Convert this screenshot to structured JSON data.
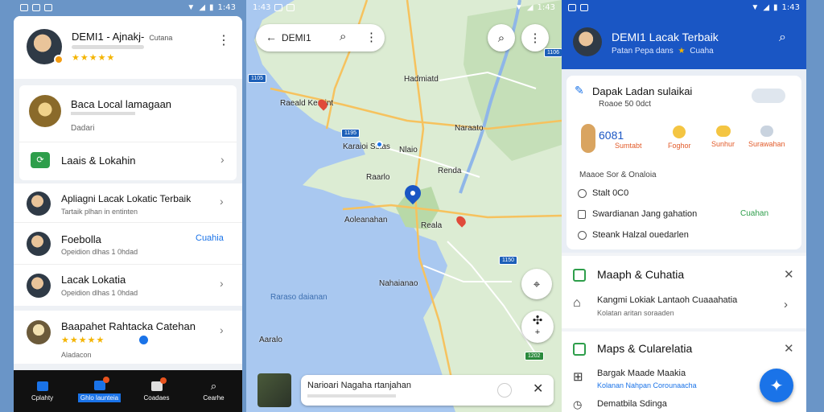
{
  "status": {
    "left_time": "1:43",
    "map_time": "1:43",
    "right_time": "1:43"
  },
  "left": {
    "header": {
      "title": "DEMI1 - Ajnakj-",
      "subtitle_right": "Cutana",
      "rating": "★★★★★",
      "sub": ""
    },
    "card1": {
      "title": "Baca Local lamagaan",
      "sub": "Dadari"
    },
    "card2": {
      "label": "Laais & Lokahin"
    },
    "list": [
      {
        "title": "Apliagni Lacak Lokatic Terbaik",
        "sub": "Tartaik plhan in entinten",
        "action": ""
      },
      {
        "title": "Foebolla",
        "sub": "Opeidion dlhas 1 0hdad",
        "action": "Cuahia"
      },
      {
        "title": "Lacak Lokatia",
        "sub": "Opeidion dlhas 1 0hdad",
        "action": ""
      },
      {
        "title": "Baapahet Rahtacka Catehan",
        "sub": "Aladacon",
        "action": "",
        "rating": "★★★★★"
      }
    ],
    "nav": [
      {
        "label": "Cplahty"
      },
      {
        "label": "Ghlo launteia"
      },
      {
        "label": "Coadaes"
      },
      {
        "label": "Cearhe"
      }
    ]
  },
  "map": {
    "search_text": "DEMI1",
    "places": [
      "Hadmiatd",
      "Raeald Keraint",
      "Karaioi Sstas",
      "Nlaio",
      "Renda",
      "Raarlo",
      "Reala",
      "Aoleanahan",
      "Naraato",
      "Nahaianao",
      "Aaralo"
    ],
    "water_label": "Raraso daianan",
    "road_tags": [
      "1105",
      "1195",
      "1106",
      "1150",
      "1202"
    ],
    "bottom_card": {
      "text": "Narioari Nagaha rtanjahan"
    }
  },
  "right": {
    "header": {
      "title": "DEMI1 Lacak Terbaik",
      "subtitle": "Patan Pepa dans",
      "subtitle_2": "Cuaha"
    },
    "weather": {
      "title": "Dapak Ladan sulaikai",
      "sub": "Roaoe 50 0dct",
      "temp": "6081",
      "items": [
        "Sumtabt",
        "Foghor",
        "Sunhur",
        "Surawahan"
      ]
    },
    "options_title": "Maaoe Sor & Onaloia",
    "options": [
      {
        "label": "Stalt 0C0"
      },
      {
        "label": "Swardianan Jang gahation",
        "action": "Cuahan"
      },
      {
        "label": "Steank Halzal ouedarlen"
      }
    ],
    "sec1": {
      "title": "Maaph & Cuhatia",
      "item_title": "Kangmi Lokiak Lantaoh Cuaaahatia",
      "item_sub": "Kolatan aritan soraaden"
    },
    "sec2": {
      "title": "Maps & Cularelatia",
      "item1_title": "Bargak Maade Maakia",
      "item1_sub": "Kolanan Nahpan Corounaacha",
      "item2_title": "Dematbila Sdinga"
    }
  }
}
